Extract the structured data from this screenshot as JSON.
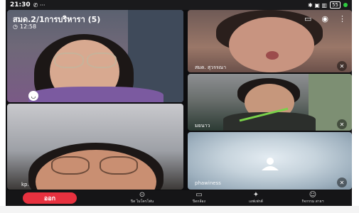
{
  "status_bar": {
    "time": "21:30",
    "left_icons": "✆ ···",
    "right_icons": "✱ ▣ ▥",
    "battery": "55"
  },
  "call": {
    "title": "สมด.2/1การบริหารา (5)",
    "timer": "12:58"
  },
  "participants": [
    {
      "name": ""
    },
    {
      "name": "kp."
    },
    {
      "name": "สมด. สุวรรณา"
    },
    {
      "name": "มยนาว"
    },
    {
      "name": "phawiness"
    }
  ],
  "controls": {
    "leave_label": "ออก",
    "items": [
      {
        "label": "ปิด\nไมโครโฟน"
      },
      {
        "label": "ปิดกล้อง"
      },
      {
        "label": "เอฟเฟกต์"
      },
      {
        "label": "กิจกรรม\nสาธฯ"
      }
    ]
  },
  "colors": {
    "leave": "#e8313f",
    "background": "#0d0d0f",
    "status_dot": "#2ecc40"
  }
}
